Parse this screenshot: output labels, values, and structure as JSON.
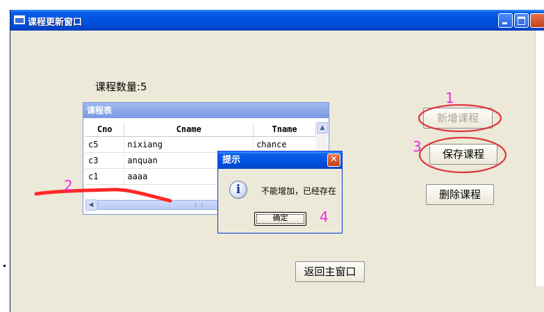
{
  "window": {
    "title": "课程更新窗口"
  },
  "course_count_label": "课程数量:5",
  "table": {
    "frame_title": "课程表",
    "columns": [
      "Cno",
      "Cname",
      "Tname"
    ],
    "rows": [
      [
        "c5",
        "nixiang",
        "chance"
      ],
      [
        "c3",
        "anquan",
        ""
      ],
      [
        "c1",
        "aaaa",
        ""
      ]
    ]
  },
  "buttons": {
    "add": "新增课程",
    "save": "保存课程",
    "delete": "删除课程",
    "back": "返回主窗口"
  },
  "dialog": {
    "title": "提示",
    "message": "不能增加，已经存在",
    "ok": "确定",
    "icon": "info-icon"
  },
  "annotations": {
    "n1": "1",
    "n2": "2",
    "n3": "3",
    "n4": "4"
  },
  "colors": {
    "annotation": "#ee2adf",
    "circle": "#e0353d",
    "underline": "#ff2a2a"
  }
}
